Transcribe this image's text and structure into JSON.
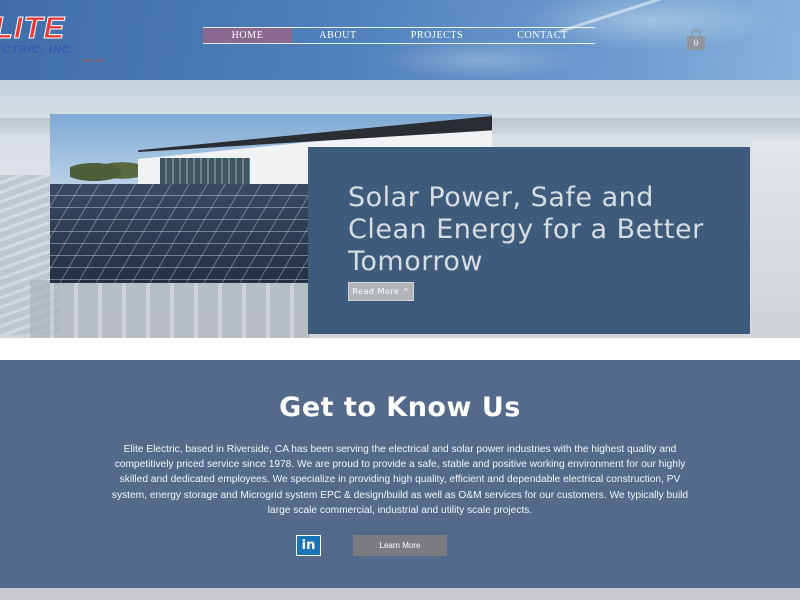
{
  "header": {
    "logo": {
      "main": "LITE",
      "sub": "ECTRIC, INC.",
      "since": "SINCE 1978"
    },
    "nav": [
      {
        "label": "HOME",
        "active": true
      },
      {
        "label": "ABOUT",
        "active": false
      },
      {
        "label": "PROJECTS",
        "active": false
      },
      {
        "label": "CONTACT",
        "active": false
      }
    ],
    "cart": {
      "icon": "shopping-bag-icon",
      "count": "0"
    }
  },
  "hero": {
    "title": "Solar Power, Safe and Clean Energy for a Better Tomorrow",
    "read_more": "Read More"
  },
  "about": {
    "title": "Get to Know Us",
    "body": "Elite Electric, based in Riverside, CA has been serving the electrical and solar power industries with the highest quality and competitively priced service since 1978. We are proud to provide a safe, stable and positive working environment for our highly skilled and dedicated employees. We specialize in providing high quality, efficient and dependable electrical construction, PV system, energy storage and Microgrid system EPC & design/build  as well as O&M services for our customers. We typically build large scale commercial, industrial and utility scale projects.",
    "social_icon": "linkedin-icon",
    "learn_more": "Learn More"
  },
  "colors": {
    "header_blue": "#4f7fba",
    "nav_active": "#8a6890",
    "hero_card": "#3e5b7c",
    "about_bg": "#536a8a",
    "logo_red": "#e63a3a",
    "linkedin_blue": "#1a74b8"
  }
}
